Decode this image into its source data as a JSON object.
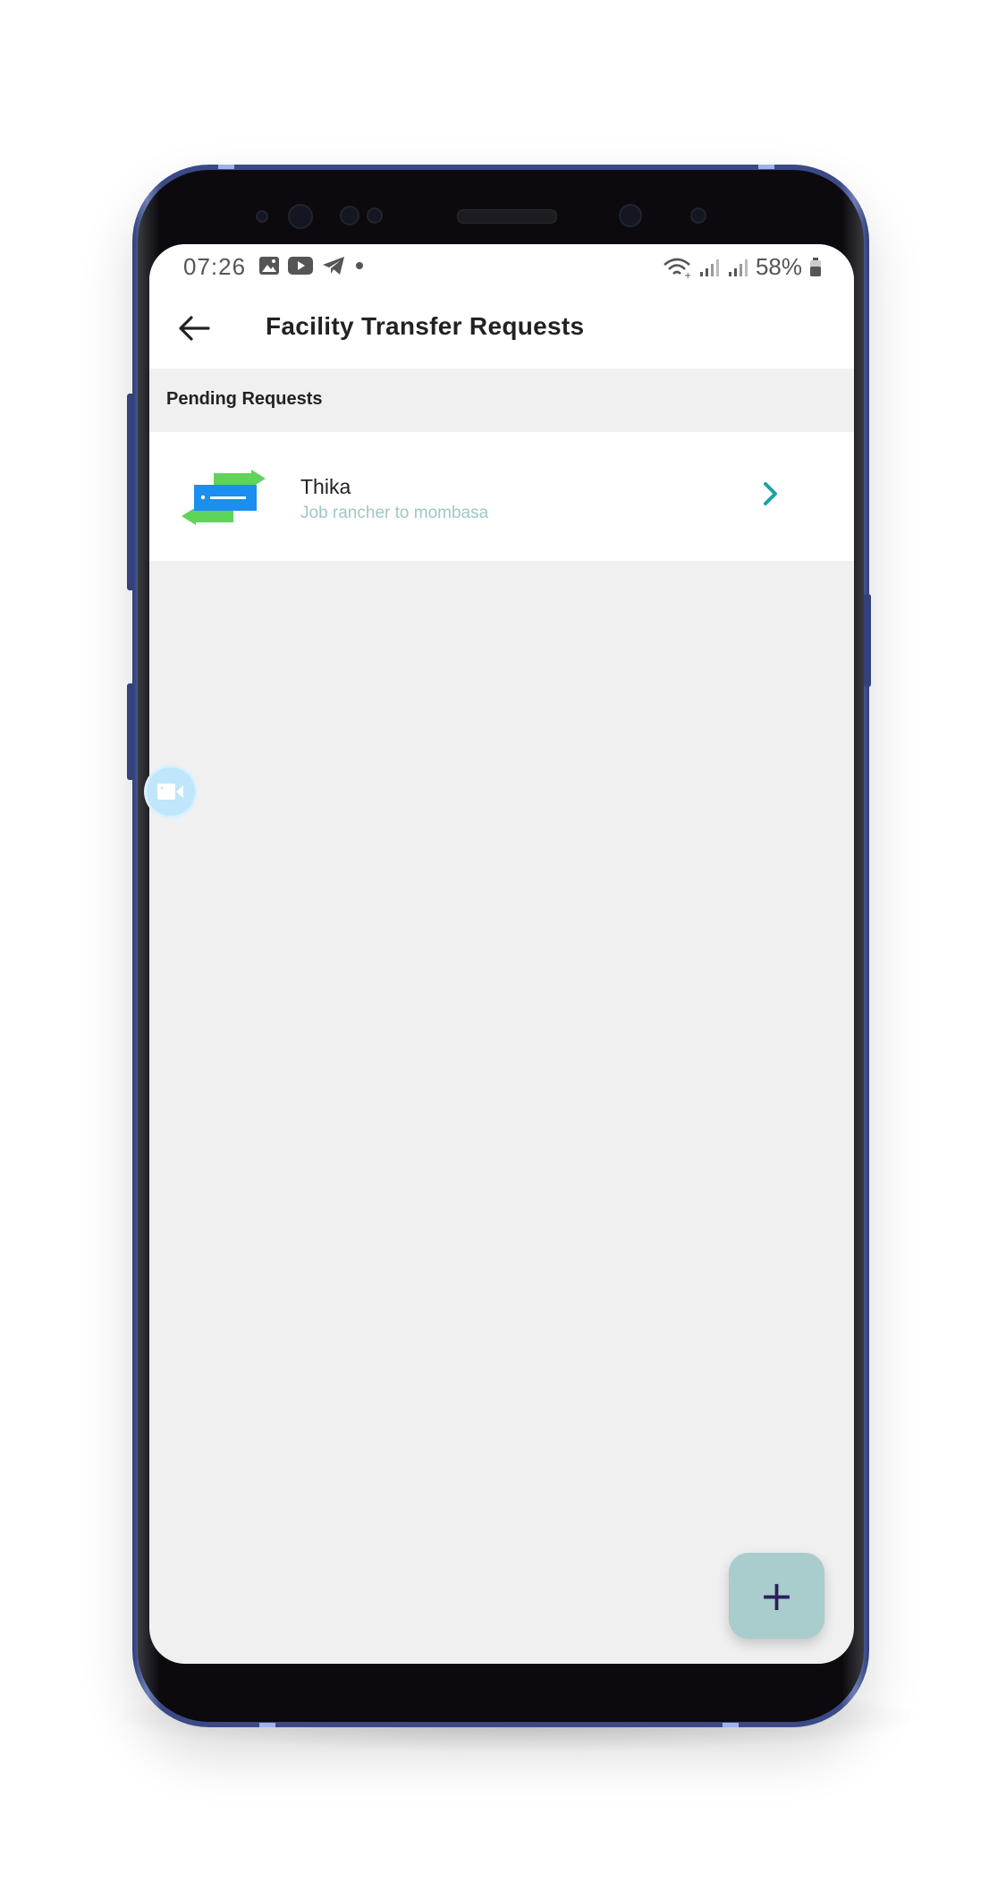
{
  "status_bar": {
    "time": "07:26",
    "notification_icons": [
      "image-icon",
      "youtube-icon",
      "telegram-icon",
      "dot-icon"
    ],
    "system_icons": [
      "wifi-icon",
      "signal-icon",
      "signal-icon"
    ],
    "battery_percent": "58%"
  },
  "app_bar": {
    "title": "Facility Transfer Requests",
    "back_icon": "back-arrow-icon"
  },
  "section": {
    "label": "Pending Requests"
  },
  "requests": [
    {
      "title": "Thika",
      "subtitle": "Job rancher to mombasa",
      "icon": "transfer-icon",
      "chevron": "chevron-right-icon"
    }
  ],
  "fab": {
    "label": "+",
    "icon": "add-icon"
  },
  "colors": {
    "accent": "#1aa3a3",
    "fab_background": "#a9cccc",
    "subtitle": "#9ec7c7",
    "screen_background": "#f0f0f0"
  }
}
